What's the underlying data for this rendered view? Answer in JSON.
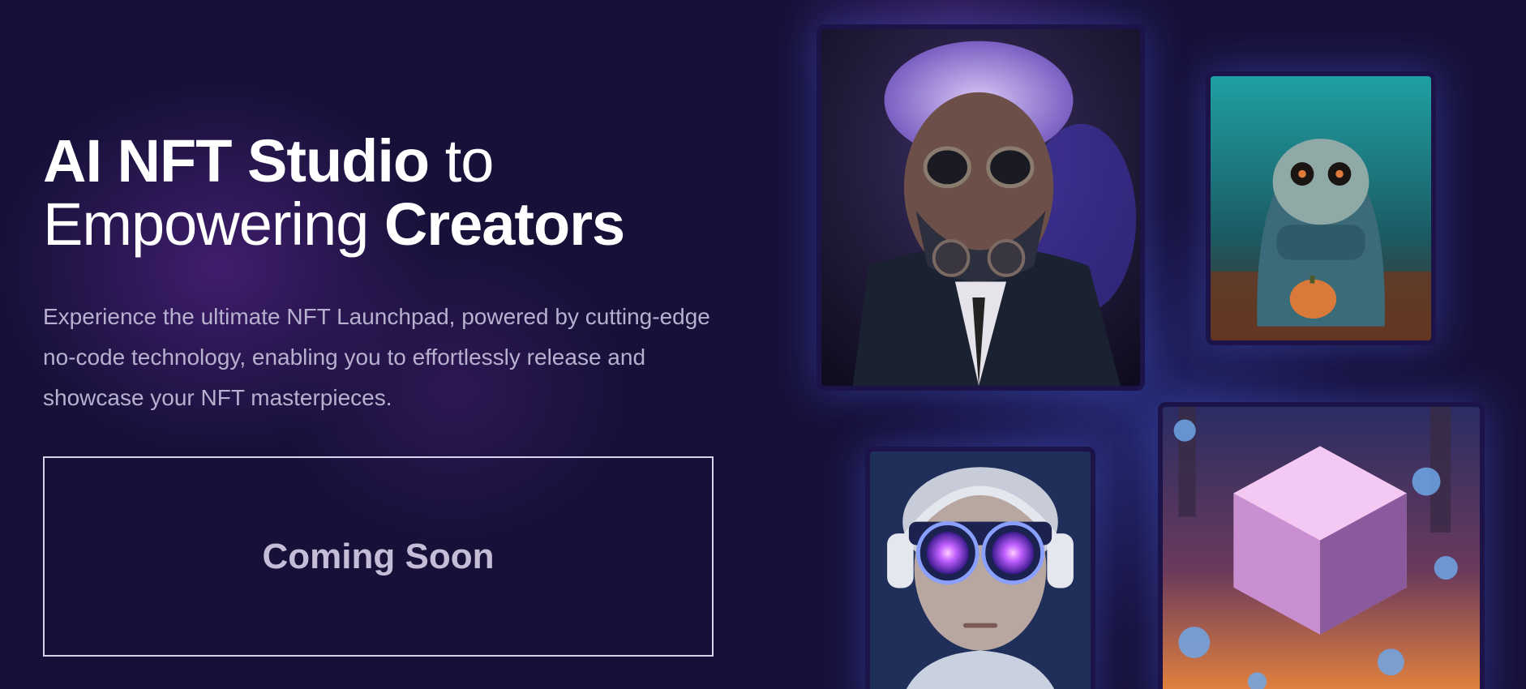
{
  "hero": {
    "title_bold_1": "AI NFT Studio",
    "title_regular_1": " to",
    "title_regular_2": "Empowering ",
    "title_bold_2": "Creators",
    "description": "Experience the ultimate NFT Launchpad, powered by cutting-edge no-code technology, enabling you to effortlessly release and showcase your NFT masterpieces.",
    "cta_label": "Coming Soon"
  },
  "colors": {
    "background": "#17113a",
    "card_border": "#1c1448",
    "cta_border": "#d9d2ec",
    "cta_text": "#c5bdd8",
    "description_text": "#b7b0cf"
  },
  "gallery": [
    {
      "name": "nft-steampunk-old-man",
      "subject": "old man with goggles and gas mask"
    },
    {
      "name": "nft-hooded-creature",
      "subject": "knitted hooded creature holding pumpkin"
    },
    {
      "name": "nft-vr-headset-woman",
      "subject": "woman with headphones and glowing goggles"
    },
    {
      "name": "nft-voxel-cube",
      "subject": "pink voxel cube with floating bubbles"
    }
  ]
}
